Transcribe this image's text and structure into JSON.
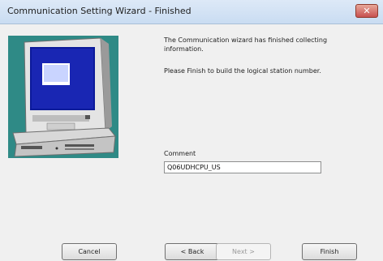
{
  "window": {
    "title": "Communication Setting Wizard - Finished",
    "close_label": "✕"
  },
  "message": {
    "line1": "The Communication wizard has finished collecting information.",
    "line2": "Please Finish to build the logical station number."
  },
  "comment": {
    "label": "Comment",
    "value": "Q06UDHCPU_US"
  },
  "buttons": {
    "cancel": "Cancel",
    "back": "< Back",
    "next": "Next >",
    "finish": "Finish"
  }
}
